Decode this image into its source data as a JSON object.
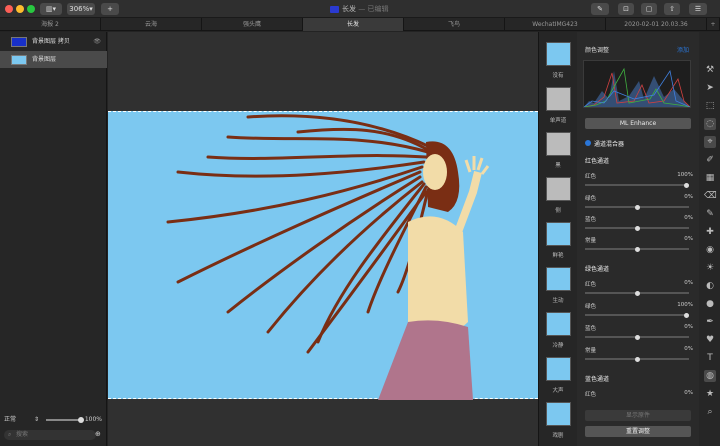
{
  "window": {
    "title": "长发",
    "subtitle": "— 已编辑",
    "zoom": "306%"
  },
  "tabs": [
    "海报 2",
    "云海",
    "强头鹰",
    "长发",
    "飞鸟",
    "WechatIMG423",
    "2020-02-01 20.03.36"
  ],
  "layers": [
    {
      "name": "背景图层 拷贝"
    },
    {
      "name": "背景图层"
    }
  ],
  "bottom": {
    "blend": "正常",
    "opacity": "100%",
    "search_placeholder": "搜索"
  },
  "presets": [
    "没有",
    "单声道",
    "黑",
    "侧",
    "鲜艳",
    "生动",
    "冷静",
    "大声",
    "戏剧"
  ],
  "panel": {
    "header": "颜色调整",
    "add": "添加",
    "ml": "ML Enhance",
    "mixer": "通道混合器",
    "red_section": "红色通道",
    "green_section": "绿色通道",
    "blue_section": "蓝色通道",
    "red_rows": [
      {
        "label": "红色",
        "value": "100%"
      },
      {
        "label": "绿色",
        "value": "0%"
      },
      {
        "label": "蓝色",
        "value": "0%"
      },
      {
        "label": "常量",
        "value": "0%"
      }
    ],
    "green_rows": [
      {
        "label": "红色",
        "value": "0%"
      },
      {
        "label": "绿色",
        "value": "100%"
      },
      {
        "label": "蓝色",
        "value": "0%"
      },
      {
        "label": "常量",
        "value": "0%"
      }
    ],
    "blue_rows": [
      {
        "label": "红色",
        "value": "0%"
      }
    ],
    "show_original": "显示原件",
    "reset": "重置调整"
  },
  "colors": {
    "sky": "#7cc8f0",
    "hair": "#7a2e14",
    "skin": "#f2dca8",
    "pants": "#b0758c",
    "accent": "#2a76d8"
  },
  "icons": [
    "wand-icon",
    "pointer-icon",
    "marquee-icon",
    "lasso-icon",
    "magic-select-icon",
    "brush-icon",
    "gradient-icon",
    "eraser-icon",
    "clone-icon",
    "heal-icon",
    "blur-icon",
    "lighten-icon",
    "sponge-icon",
    "shape-icon",
    "pen-icon",
    "heart-icon",
    "text-icon",
    "color-adjust-icon",
    "star-icon",
    "zoom-icon"
  ]
}
